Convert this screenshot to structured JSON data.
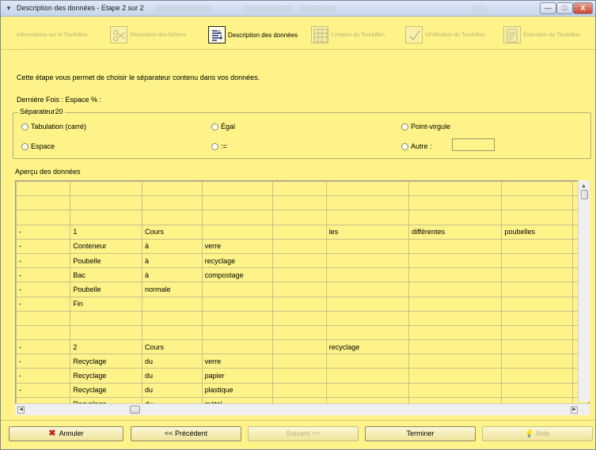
{
  "window": {
    "title": "Description des données - Etape 2 sur 2",
    "min_label": "—",
    "max_label": "□",
    "close_label": "X"
  },
  "steps": [
    {
      "label": "Informations sur le Tourbillon",
      "icon": "info-icon",
      "active": false
    },
    {
      "label": "Séparation des fichiers",
      "icon": "scissors-icon",
      "active": false
    },
    {
      "label": "Description des données",
      "icon": "data-description-icon",
      "active": true
    },
    {
      "label": "Création du Tourbillon",
      "icon": "grid-create-icon",
      "active": false
    },
    {
      "label": "Vérification du Tourbillon",
      "icon": "checkmark-icon",
      "active": false
    },
    {
      "label": "Exécution du Tourbillon",
      "icon": "execute-icon",
      "active": false
    }
  ],
  "content": {
    "intro": "Cette étape vous permet de choisir le séparateur contenu dans vos données.",
    "last_time": "Dernière Fois :   Espace   %   :",
    "group_legend": "Séparateur20",
    "radios": [
      {
        "label": "Tabulation (carré)",
        "checked": false
      },
      {
        "label": "Égal",
        "checked": false
      },
      {
        "label": "Point-virgule",
        "checked": false
      },
      {
        "label": "Espace",
        "checked": false
      },
      {
        "label": ":=",
        "checked": false
      },
      {
        "label": "Autre :",
        "checked": false
      }
    ],
    "autre_value": "",
    "preview_label": "Aperçu des données"
  },
  "grid": {
    "rows": [
      [
        "",
        "",
        "",
        "",
        "",
        "",
        "",
        "",
        ""
      ],
      [
        "",
        "",
        "",
        "",
        "",
        "",
        "",
        "",
        ""
      ],
      [
        "",
        "",
        "",
        "",
        "",
        "",
        "",
        "",
        ""
      ],
      [
        "-",
        "1",
        "Cours",
        "",
        "",
        "les",
        "différentes",
        "poubelles",
        ""
      ],
      [
        "-",
        "Conteneur",
        "à",
        "verre",
        "",
        "",
        "",
        "",
        ""
      ],
      [
        "-",
        "Poubelle",
        "à",
        "recyclage",
        "",
        "",
        "",
        "",
        ""
      ],
      [
        "-",
        "Bac",
        "à",
        "compostage",
        "",
        "",
        "",
        "",
        ""
      ],
      [
        "-",
        "Poubelle",
        "normale",
        "",
        "",
        "",
        "",
        "",
        ""
      ],
      [
        "-",
        "Fin",
        "",
        "",
        "",
        "",
        "",
        "",
        ""
      ],
      [
        "",
        "",
        "",
        "",
        "",
        "",
        "",
        "",
        ""
      ],
      [
        "",
        "",
        "",
        "",
        "",
        "",
        "",
        "",
        ""
      ],
      [
        "-",
        "2",
        "Cours",
        "",
        "",
        "recyclage",
        "",
        "",
        ""
      ],
      [
        "-",
        "Recyclage",
        "du",
        "verre",
        "",
        "",
        "",
        "",
        ""
      ],
      [
        "-",
        "Recyclage",
        "du",
        "papier",
        "",
        "",
        "",
        "",
        ""
      ],
      [
        "-",
        "Recyclage",
        "du",
        "plastique",
        "",
        "",
        "",
        "",
        ""
      ],
      [
        "-",
        "Recyclage",
        "du",
        "métal",
        "",
        "",
        "",
        "",
        ""
      ]
    ]
  },
  "buttons": {
    "annuler": "Annuler",
    "precedent": "<< Précédent",
    "suivant": "Suivant >>",
    "terminer": "Terminer",
    "aide": "Aide"
  },
  "colors": {
    "background": "#fdf388",
    "grid_line": "#c9c08a",
    "disabled_text": "#bab27a"
  }
}
